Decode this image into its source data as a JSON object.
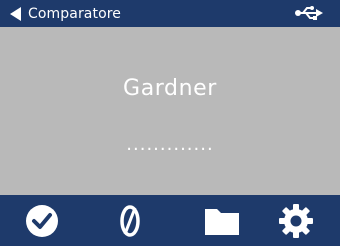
{
  "header": {
    "title": "Comparatore",
    "back_icon": "back-arrow-icon",
    "status_icon": "usb-icon"
  },
  "main": {
    "label": "Gardner",
    "value": "............."
  },
  "toolbar": {
    "items": [
      {
        "icon": "check-circle-icon"
      },
      {
        "icon": "zero-icon"
      },
      {
        "icon": "folder-icon"
      },
      {
        "icon": "gear-icon"
      }
    ]
  },
  "colors": {
    "bar": "#1e3a6b",
    "panel": "#b9b9b9",
    "text": "#ffffff"
  }
}
